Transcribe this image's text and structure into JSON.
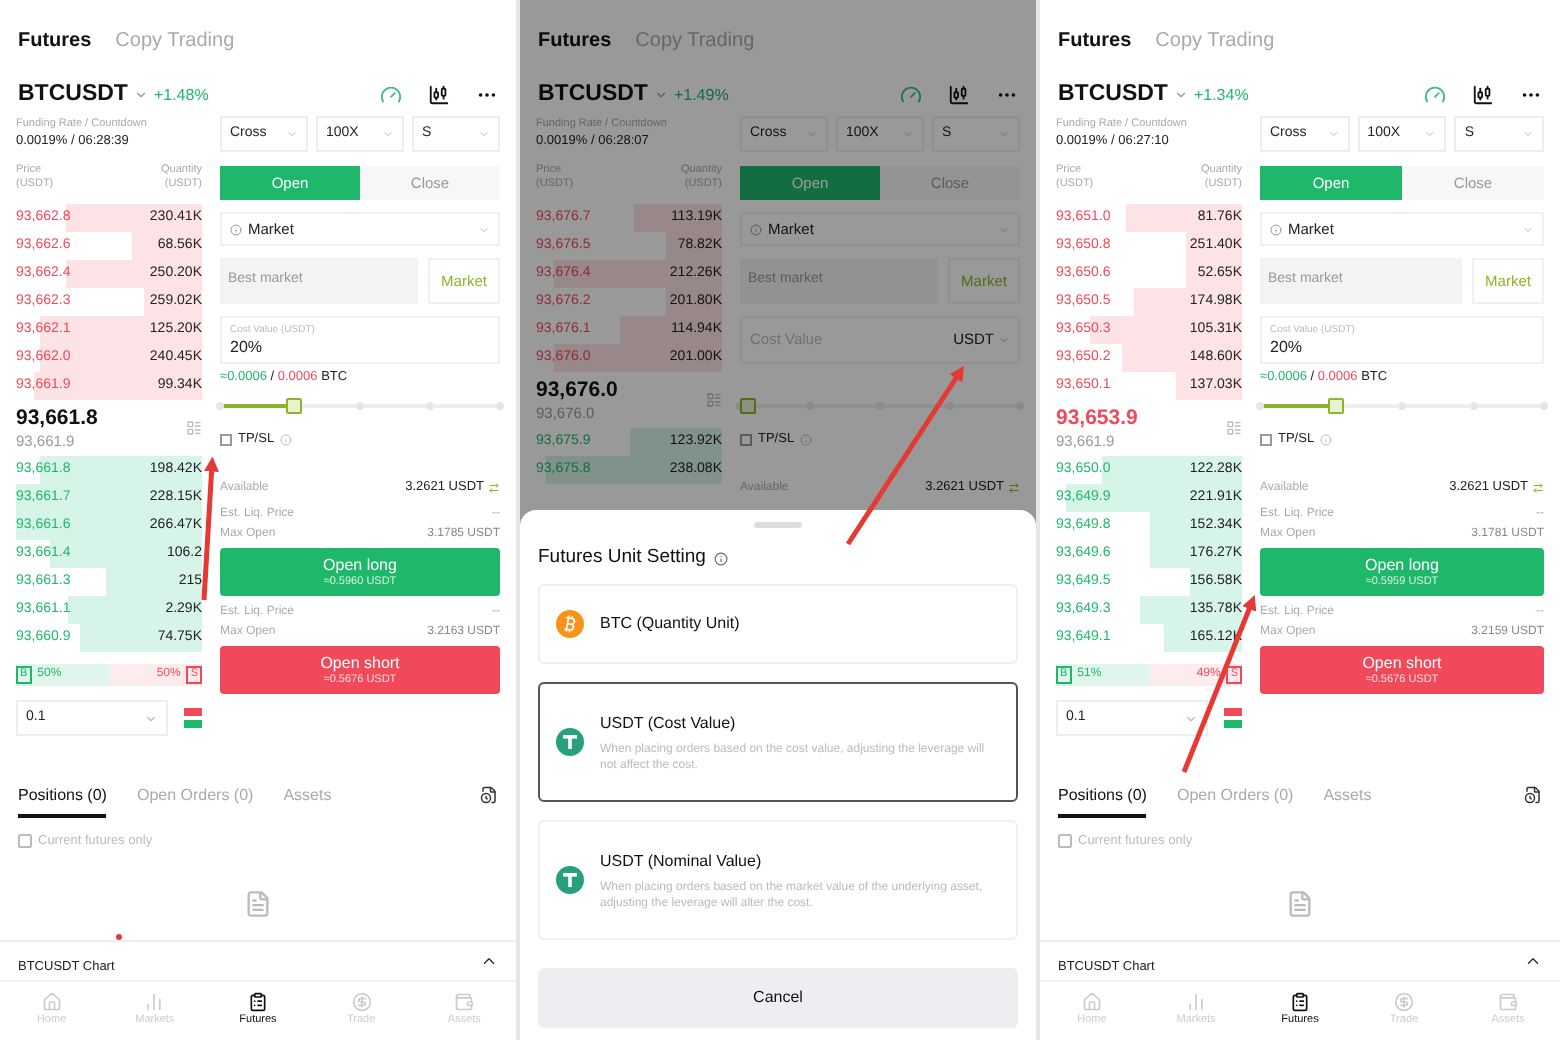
{
  "screens": [
    {
      "tabs": [
        {
          "label": "Futures",
          "selected": true
        },
        {
          "label": "Copy Trading",
          "selected": false
        }
      ],
      "symbol": "BTCUSDT",
      "change": "+1.48%",
      "funding_label": "Funding Rate / Countdown",
      "funding_rate": "0.0019% /",
      "countdown": "06:28:39",
      "price_header": "Price (USDT)",
      "qty_header": "Quantity (USDT)",
      "asks": [
        {
          "price": "93,662.8",
          "qty": "230.41K",
          "level": 0.73
        },
        {
          "price": "93,662.6",
          "qty": "68.56K",
          "level": 0.38
        },
        {
          "price": "93,662.4",
          "qty": "250.20K",
          "level": 0.73
        },
        {
          "price": "93,662.3",
          "qty": "259.02K",
          "level": 0.31
        },
        {
          "price": "93,662.1",
          "qty": "125.20K",
          "level": 0.87
        },
        {
          "price": "93,662.0",
          "qty": "240.45K",
          "level": 0.87
        },
        {
          "price": "93,661.9",
          "qty": "99.34K",
          "level": 0.9
        }
      ],
      "last_price": "93,661.8",
      "falling": false,
      "mark_price": "93,661.9",
      "bids": [
        {
          "price": "93,661.8",
          "qty": "198.42K",
          "level": 0.87
        },
        {
          "price": "93,661.7",
          "qty": "228.15K",
          "level": 1
        },
        {
          "price": "93,661.6",
          "qty": "266.47K",
          "level": 1
        },
        {
          "price": "93,661.4",
          "qty": "106.2",
          "level": 0.82
        },
        {
          "price": "93,661.3",
          "qty": "215",
          "level": 0.52
        },
        {
          "price": "93,661.1",
          "qty": "2.29K",
          "level": 0.72
        },
        {
          "price": "93,660.9",
          "qty": "74.75K",
          "level": 0.66
        }
      ],
      "ratio": {
        "buy": "50%",
        "sell": "50%",
        "buy_mark": "B",
        "sell_mark": "S",
        "level": 0.5
      },
      "depth": "0.1",
      "selects": [
        "Cross",
        "100X",
        "S"
      ],
      "order_tabs": [
        {
          "label": "Open",
          "selected": true
        },
        {
          "label": "Close",
          "selected": false
        }
      ],
      "order_type": "Market",
      "price_placeholder": "Best market",
      "price_button": "Market",
      "amount": {
        "kind": "filled",
        "label": "Cost Value (USDT)",
        "value": "20%"
      },
      "estimate": {
        "low": "≈0.0006",
        "separator": "/",
        "high": "0.0006",
        "unit": "BTC"
      },
      "slider": {
        "level": 0.25
      },
      "tpsl": {
        "label": "TP/SL",
        "checked": false
      },
      "available": {
        "label": "Available",
        "value": "3.2621 USDT"
      },
      "long": {
        "liq_label": "Est. Liq. Price",
        "liq_value": "--",
        "max_label": "Max Open",
        "max_value": "3.1785 USDT",
        "button": "Open long",
        "sub": "≈0.5960 USDT"
      },
      "short": {
        "liq_label": "Est. Liq. Price",
        "liq_value": "--",
        "max_label": "Max Open",
        "max_value": "3.2163 USDT",
        "button": "Open short",
        "sub": "≈0.5676 USDT"
      },
      "bottom_tabs": [
        {
          "label": "Positions (0)",
          "selected": true
        },
        {
          "label": "Open Orders (0)",
          "selected": false
        },
        {
          "label": "Assets",
          "selected": false
        }
      ],
      "current_only": {
        "label": "Current futures only",
        "checked": false
      },
      "chart": {
        "label": "BTCUSDT Chart",
        "alert": true
      },
      "nav": [
        {
          "label": "Home",
          "selected": false
        },
        {
          "label": "Markets",
          "selected": false
        },
        {
          "label": "Futures",
          "selected": true
        },
        {
          "label": "Trade",
          "selected": false
        },
        {
          "label": "Assets",
          "selected": false
        }
      ]
    },
    {
      "tabs": [
        {
          "label": "Futures",
          "selected": true
        },
        {
          "label": "Copy Trading",
          "selected": false
        }
      ],
      "symbol": "BTCUSDT",
      "change": "+1.49%",
      "funding_label": "Funding Rate / Countdown",
      "funding_rate": "0.0019% /",
      "countdown": "06:28:07",
      "price_header": "Price (USDT)",
      "qty_header": "Quantity (USDT)",
      "asks": [
        {
          "price": "93,676.7",
          "qty": "113.19K",
          "level": 0.47
        },
        {
          "price": "93,676.5",
          "qty": "78.82K",
          "level": 0.3
        },
        {
          "price": "93,676.4",
          "qty": "212.26K",
          "level": 0.9
        },
        {
          "price": "93,676.2",
          "qty": "201.80K",
          "level": 0.3
        },
        {
          "price": "93,676.1",
          "qty": "114.94K",
          "level": 0.55
        },
        {
          "price": "93,676.0",
          "qty": "201.00K",
          "level": 0.9
        }
      ],
      "last_price": "93,676.0",
      "falling": false,
      "mark_price": "93,676.0",
      "bids": [
        {
          "price": "93,675.9",
          "qty": "123.92K",
          "level": 0.5
        },
        {
          "price": "93,675.8",
          "qty": "238.08K",
          "level": 0.95
        }
      ],
      "selects": [
        "Cross",
        "100X",
        "S"
      ],
      "order_tabs": [
        {
          "label": "Open",
          "selected": true
        },
        {
          "label": "Close",
          "selected": false
        }
      ],
      "order_type": "Market",
      "price_placeholder": "Best market",
      "price_button": "Market",
      "amount": {
        "kind": "unit",
        "placeholder": "Cost Value",
        "unit": "USDT"
      },
      "slider": {
        "level": 0
      },
      "tpsl": {
        "label": "TP/SL",
        "checked": false
      },
      "available": {
        "label": "Available",
        "value": "3.2621 USDT"
      },
      "sheet": {
        "title": "Futures Unit Setting",
        "cancel": "Cancel",
        "options": [
          {
            "kind": "btc",
            "title": "BTC (Quantity Unit)",
            "selected": false
          },
          {
            "kind": "usdt",
            "title": "USDT (Cost Value)",
            "description": "When placing orders based on the cost value, adjusting the leverage will not affect the cost.",
            "selected": true
          },
          {
            "kind": "usdt",
            "title": "USDT (Nominal Value)",
            "description": "When placing orders based on the market value of the underlying asset, adjusting the leverage will alter the cost.",
            "selected": false
          }
        ]
      }
    },
    {
      "tabs": [
        {
          "label": "Futures",
          "selected": true
        },
        {
          "label": "Copy Trading",
          "selected": false
        }
      ],
      "symbol": "BTCUSDT",
      "change": "+1.34%",
      "funding_label": "Funding Rate / Countdown",
      "funding_rate": "0.0019% /",
      "countdown": "06:27:10",
      "price_header": "Price (USDT)",
      "qty_header": "Quantity (USDT)",
      "asks": [
        {
          "price": "93,651.0",
          "qty": "81.76K",
          "level": 0.62
        },
        {
          "price": "93,650.8",
          "qty": "251.40K",
          "level": 0.3
        },
        {
          "price": "93,650.6",
          "qty": "52.65K",
          "level": 0.3
        },
        {
          "price": "93,650.5",
          "qty": "174.98K",
          "level": 0.58
        },
        {
          "price": "93,650.3",
          "qty": "105.31K",
          "level": 0.82
        },
        {
          "price": "93,650.2",
          "qty": "148.60K",
          "level": 0.65
        },
        {
          "price": "93,650.1",
          "qty": "137.03K",
          "level": 0.35
        }
      ],
      "last_price": "93,653.9",
      "falling": true,
      "mark_price": "93,661.9",
      "bids": [
        {
          "price": "93,650.0",
          "qty": "122.28K",
          "level": 0.75
        },
        {
          "price": "93,649.9",
          "qty": "221.91K",
          "level": 0.95
        },
        {
          "price": "93,649.8",
          "qty": "152.34K",
          "level": 0.5
        },
        {
          "price": "93,649.6",
          "qty": "176.27K",
          "level": 0.5
        },
        {
          "price": "93,649.5",
          "qty": "156.58K",
          "level": 0.28
        },
        {
          "price": "93,649.3",
          "qty": "135.78K",
          "level": 0.55
        },
        {
          "price": "93,649.1",
          "qty": "165.12K",
          "level": 0.42
        }
      ],
      "ratio": {
        "buy": "51%",
        "sell": "49%",
        "buy_mark": "B",
        "sell_mark": "S",
        "level": 0.51
      },
      "depth": "0.1",
      "selects": [
        "Cross",
        "100X",
        "S"
      ],
      "order_tabs": [
        {
          "label": "Open",
          "selected": true
        },
        {
          "label": "Close",
          "selected": false
        }
      ],
      "order_type": "Market",
      "price_placeholder": "Best market",
      "price_button": "Market",
      "amount": {
        "kind": "filled",
        "label": "Cost Value (USDT)",
        "value": "20%"
      },
      "estimate": {
        "low": "≈0.0006",
        "separator": "/",
        "high": "0.0006",
        "unit": "BTC"
      },
      "slider": {
        "level": 0.25
      },
      "tpsl": {
        "label": "TP/SL",
        "checked": false
      },
      "available": {
        "label": "Available",
        "value": "3.2621 USDT"
      },
      "long": {
        "liq_label": "Est. Liq. Price",
        "liq_value": "--",
        "max_label": "Max Open",
        "max_value": "3.1781 USDT",
        "button": "Open long",
        "sub": "≈0.5959 USDT"
      },
      "short": {
        "liq_label": "Est. Liq. Price",
        "liq_value": "--",
        "max_label": "Max Open",
        "max_value": "3.2159 USDT",
        "button": "Open short",
        "sub": "≈0.5676 USDT"
      },
      "bottom_tabs": [
        {
          "label": "Positions (0)",
          "selected": true
        },
        {
          "label": "Open Orders (0)",
          "selected": false
        },
        {
          "label": "Assets",
          "selected": false
        }
      ],
      "current_only": {
        "label": "Current futures only",
        "checked": false
      },
      "chart": {
        "label": "BTCUSDT Chart",
        "alert": false
      },
      "nav": [
        {
          "label": "Home",
          "selected": false
        },
        {
          "label": "Markets",
          "selected": false
        },
        {
          "label": "Futures",
          "selected": true
        },
        {
          "label": "Trade",
          "selected": false
        },
        {
          "label": "Assets",
          "selected": false
        }
      ]
    }
  ]
}
